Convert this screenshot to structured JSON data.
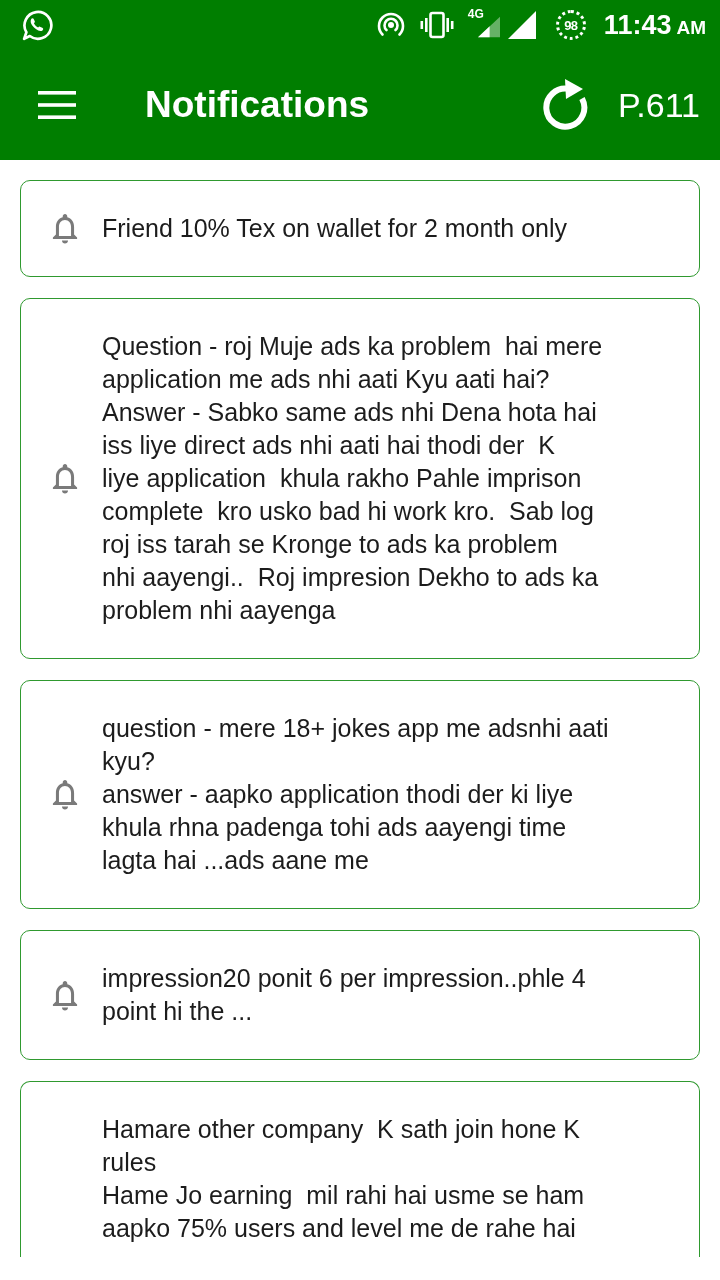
{
  "status_bar": {
    "network": "4G",
    "battery": "98",
    "time": "11:43",
    "meridiem": "AM"
  },
  "app_bar": {
    "title": "Notifications",
    "points": "P.611"
  },
  "notifications": [
    {
      "text": "Friend 10% Tex on wallet for 2 month only",
      "cut_off": false
    },
    {
      "text": "Question - roj Muje ads ka problem  hai mere\napplication me ads nhi aati Kyu aati hai?\nAnswer - Sabko same ads nhi Dena hota hai\niss liye direct ads nhi aati hai thodi der  K\nliye application  khula rakho Pahle imprison\ncomplete  kro usko bad hi work kro.  Sab log\nroj iss tarah se Kronge to ads ka problem\nnhi aayengi..  Roj impresion Dekho to ads ka\nproblem nhi aayenga",
      "cut_off": false
    },
    {
      "text": "question - mere 18+ jokes app me adsnhi aati\nkyu?\nanswer - aapko application thodi der ki liye\nkhula rhna padenga tohi ads aayengi time\nlagta hai ...ads aane me",
      "cut_off": false
    },
    {
      "text": "impression20 ponit 6 per impression..phle 4\npoint hi the ...",
      "cut_off": false
    },
    {
      "text": "Hamare other company  K sath join hone K\nrules\nHame Jo earning  mil rahi hai usme se ham\naapko 75% users and level me de rahe hai",
      "cut_off": true
    }
  ]
}
